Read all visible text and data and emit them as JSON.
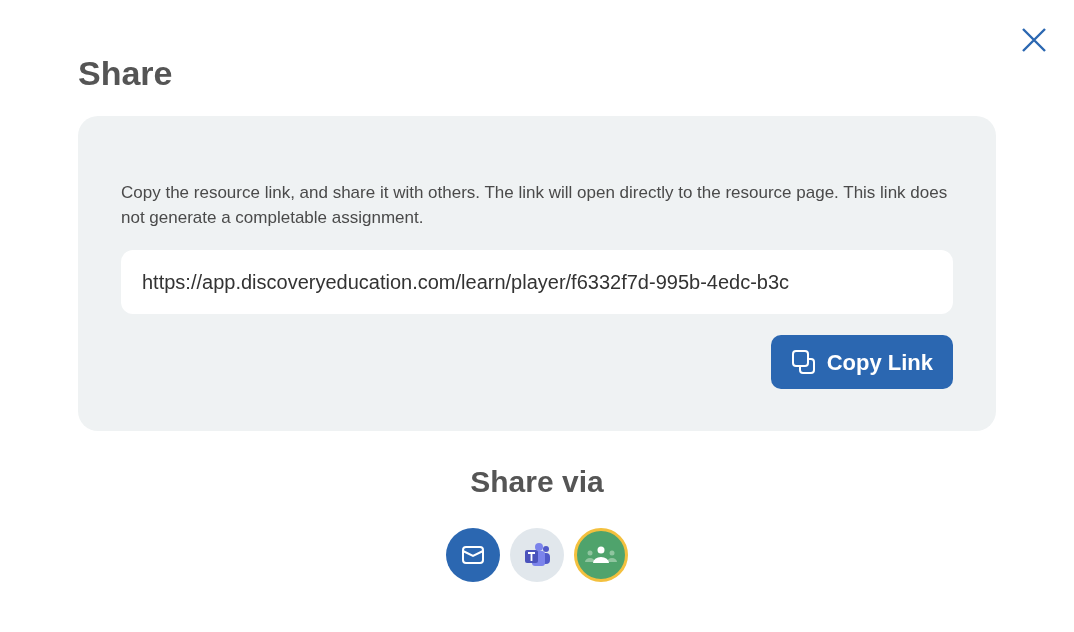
{
  "dialog": {
    "title": "Share",
    "description": "Copy the resource link, and share it with others. The link will open directly to the resource page. This link does not generate a completable assignment.",
    "link": "https://app.discoveryeducation.com/learn/player/f6332f7d-995b-4edc-b3c",
    "copy_button": "Copy Link",
    "share_via": {
      "title": "Share via",
      "options": [
        {
          "kind": "email",
          "selected": false
        },
        {
          "kind": "teams",
          "selected": false
        },
        {
          "kind": "classroom",
          "selected": true
        }
      ]
    }
  }
}
